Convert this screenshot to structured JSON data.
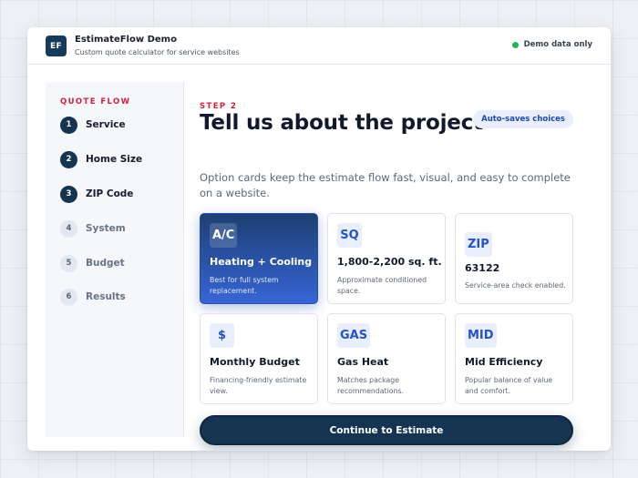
{
  "header": {
    "logo_text": "EF",
    "title": "EstimateFlow Demo",
    "subtitle": "Custom quote calculator for service websites",
    "badge": "Demo data only",
    "badge_color": "#22b35a"
  },
  "sidebar": {
    "title": "QUOTE FLOW",
    "steps": [
      {
        "num": "1",
        "label": "Service",
        "state": "complete"
      },
      {
        "num": "2",
        "label": "Home Size",
        "state": "complete"
      },
      {
        "num": "3",
        "label": "ZIP Code",
        "state": "complete"
      },
      {
        "num": "4",
        "label": "System",
        "state": "upcoming"
      },
      {
        "num": "5",
        "label": "Budget",
        "state": "upcoming"
      },
      {
        "num": "6",
        "label": "Results",
        "state": "upcoming"
      }
    ]
  },
  "main": {
    "step_tag": "STEP 2",
    "heading": "Tell us about the project",
    "autosave": "Auto-saves choices",
    "description": "Option cards keep the estimate flow fast, visual, and easy to complete on a website.",
    "cards": [
      {
        "icon": "A/C",
        "title": "Heating + Cooling",
        "subtitle": "Best for full system replacement.",
        "selected": true
      },
      {
        "icon": "SQ",
        "title": "1,800-2,200 sq. ft.",
        "subtitle": "Approximate conditioned space.",
        "selected": false
      },
      {
        "icon": "ZIP",
        "title": "63122",
        "subtitle": "Service-area check enabled.",
        "selected": false
      },
      {
        "icon": "$",
        "title": "Monthly Budget",
        "subtitle": "Financing-friendly estimate view.",
        "selected": false
      },
      {
        "icon": "GAS",
        "title": "Gas Heat",
        "subtitle": "Matches package recommendations.",
        "selected": false
      },
      {
        "icon": "MID",
        "title": "Mid Efficiency",
        "subtitle": "Popular balance of value and comfort.",
        "selected": false
      }
    ],
    "continue_label": "Continue to Estimate"
  },
  "colors": {
    "accent_red": "#d3203b",
    "navy": "#143452",
    "blue": "#2553c6"
  }
}
